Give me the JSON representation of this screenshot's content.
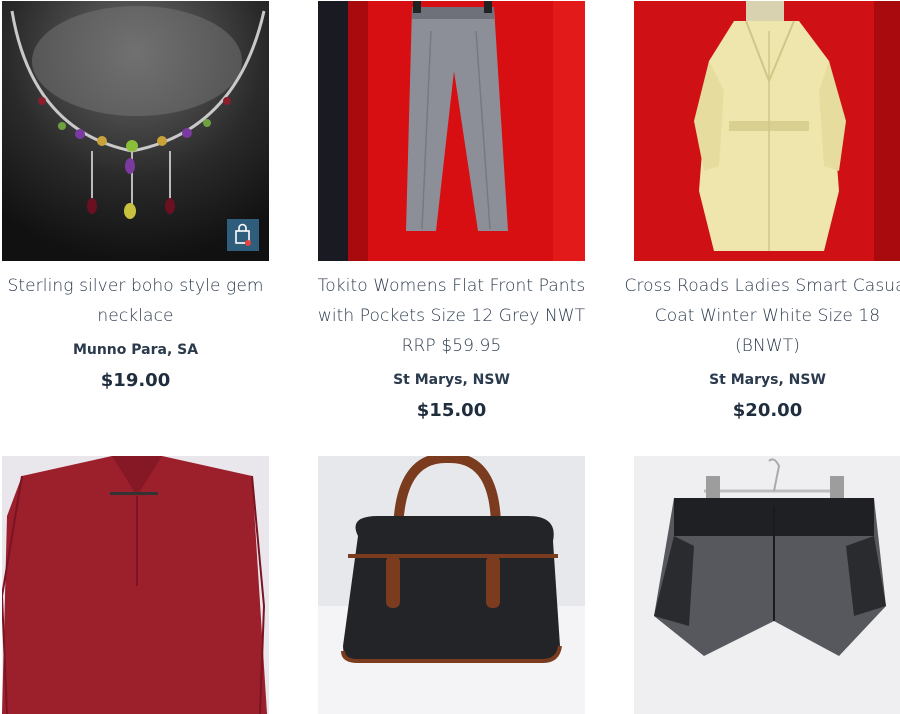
{
  "products": [
    {
      "title": "Sterling silver boho style gem necklace",
      "location": "Munno Para, SA",
      "price": "$19.00",
      "image": "necklace"
    },
    {
      "title": "Tokito Womens Flat Front Pants with Pockets Size 12 Grey NWT RRP $59.95",
      "location": "St Marys, NSW",
      "price": "$15.00",
      "image": "pants"
    },
    {
      "title": "Cross Roads Ladies Smart Casual Coat Winter White Size 18 (BNWT)",
      "location": "St Marys, NSW",
      "price": "$20.00",
      "image": "coat"
    },
    {
      "image": "red-shirt"
    },
    {
      "image": "handbag"
    },
    {
      "image": "shorts"
    }
  ],
  "colors": {
    "accent": "#2f5d7c",
    "text": "#2b3a4d",
    "price": "#1f2d3d"
  },
  "icons": {
    "add_to_cart": "shopping-bag-icon"
  }
}
